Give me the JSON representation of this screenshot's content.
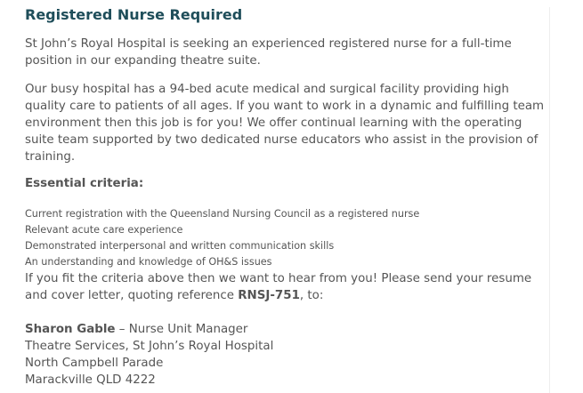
{
  "job": {
    "title": "Registered Nurse Required",
    "intro": "St John’s Royal Hospital is seeking an experienced registered nurse for a full-time position in our expanding theatre suite.",
    "description": "Our busy hospital has a 94-bed acute medical and surgical facility providing high quality care to patients of all ages. If you want to work in a dynamic and fulfilling team environment then this job is for you! We offer continual learning with the operating suite team supported by two dedicated nurse educators who assist in the provision of training.",
    "criteria_heading": "Essential criteria:",
    "criteria": [
      "Current registration with the Queensland Nursing Council as a registered nurse",
      "Relevant acute care experience",
      "Demonstrated interpersonal and written communication skills",
      "An understanding and knowledge of OH&S issues"
    ],
    "apply_before_ref": "If you fit the criteria above then we want to hear from you! Please send your resume and cover letter, quoting reference ",
    "reference": "RNSJ-751",
    "apply_after_ref": ", to:",
    "contact": {
      "name": "Sharon Gable",
      "role": " – Nurse Unit Manager",
      "department": "Theatre Services, St John’s Royal Hospital",
      "street": "North Campbell Parade",
      "city": "Marackville QLD 4222"
    }
  }
}
